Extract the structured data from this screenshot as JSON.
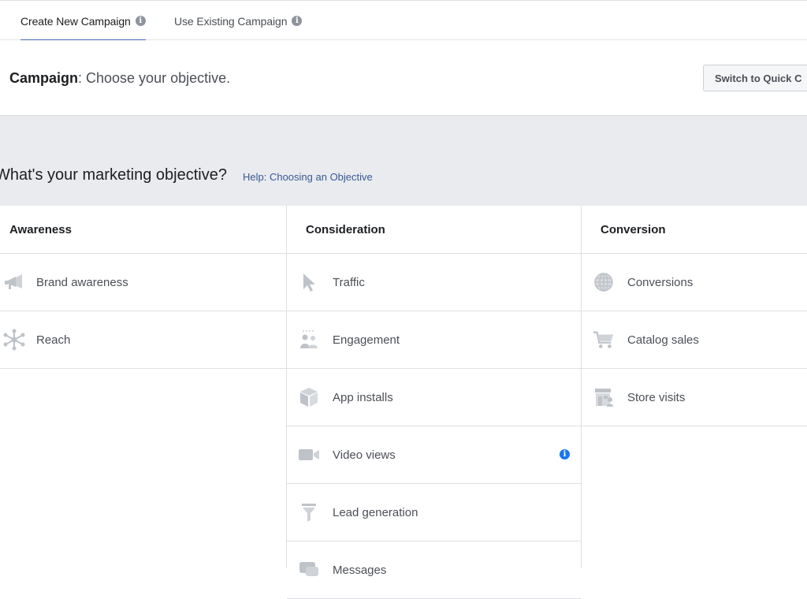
{
  "tabs": [
    {
      "label": "Create New Campaign",
      "active": true
    },
    {
      "label": "Use Existing Campaign",
      "active": false
    }
  ],
  "header": {
    "title_bold": "Campaign",
    "title_rest": ": Choose your objective.",
    "quick_button": "Switch to Quick C"
  },
  "objective": {
    "title": "What's your marketing objective?",
    "help_link": "Help: Choosing an Objective"
  },
  "columns": [
    {
      "heading": "Awareness",
      "items": [
        {
          "label": "Brand awareness",
          "icon": "megaphone-icon"
        },
        {
          "label": "Reach",
          "icon": "network-icon"
        }
      ]
    },
    {
      "heading": "Consideration",
      "items": [
        {
          "label": "Traffic",
          "icon": "cursor-icon"
        },
        {
          "label": "Engagement",
          "icon": "people-icon"
        },
        {
          "label": "App installs",
          "icon": "box-icon"
        },
        {
          "label": "Video views",
          "icon": "video-camera-icon"
        },
        {
          "label": "Lead generation",
          "icon": "funnel-icon"
        },
        {
          "label": "Messages",
          "icon": "chat-icon"
        }
      ]
    },
    {
      "heading": "Conversion",
      "items": [
        {
          "label": "Conversions",
          "icon": "globe-icon"
        },
        {
          "label": "Catalog sales",
          "icon": "cart-icon"
        },
        {
          "label": "Store visits",
          "icon": "store-icon"
        }
      ]
    }
  ],
  "colors": {
    "accent": "#4267b2",
    "link": "#385898",
    "band": "#e9ebee",
    "icon": "#bec3c9",
    "info_blue": "#1877f2"
  }
}
